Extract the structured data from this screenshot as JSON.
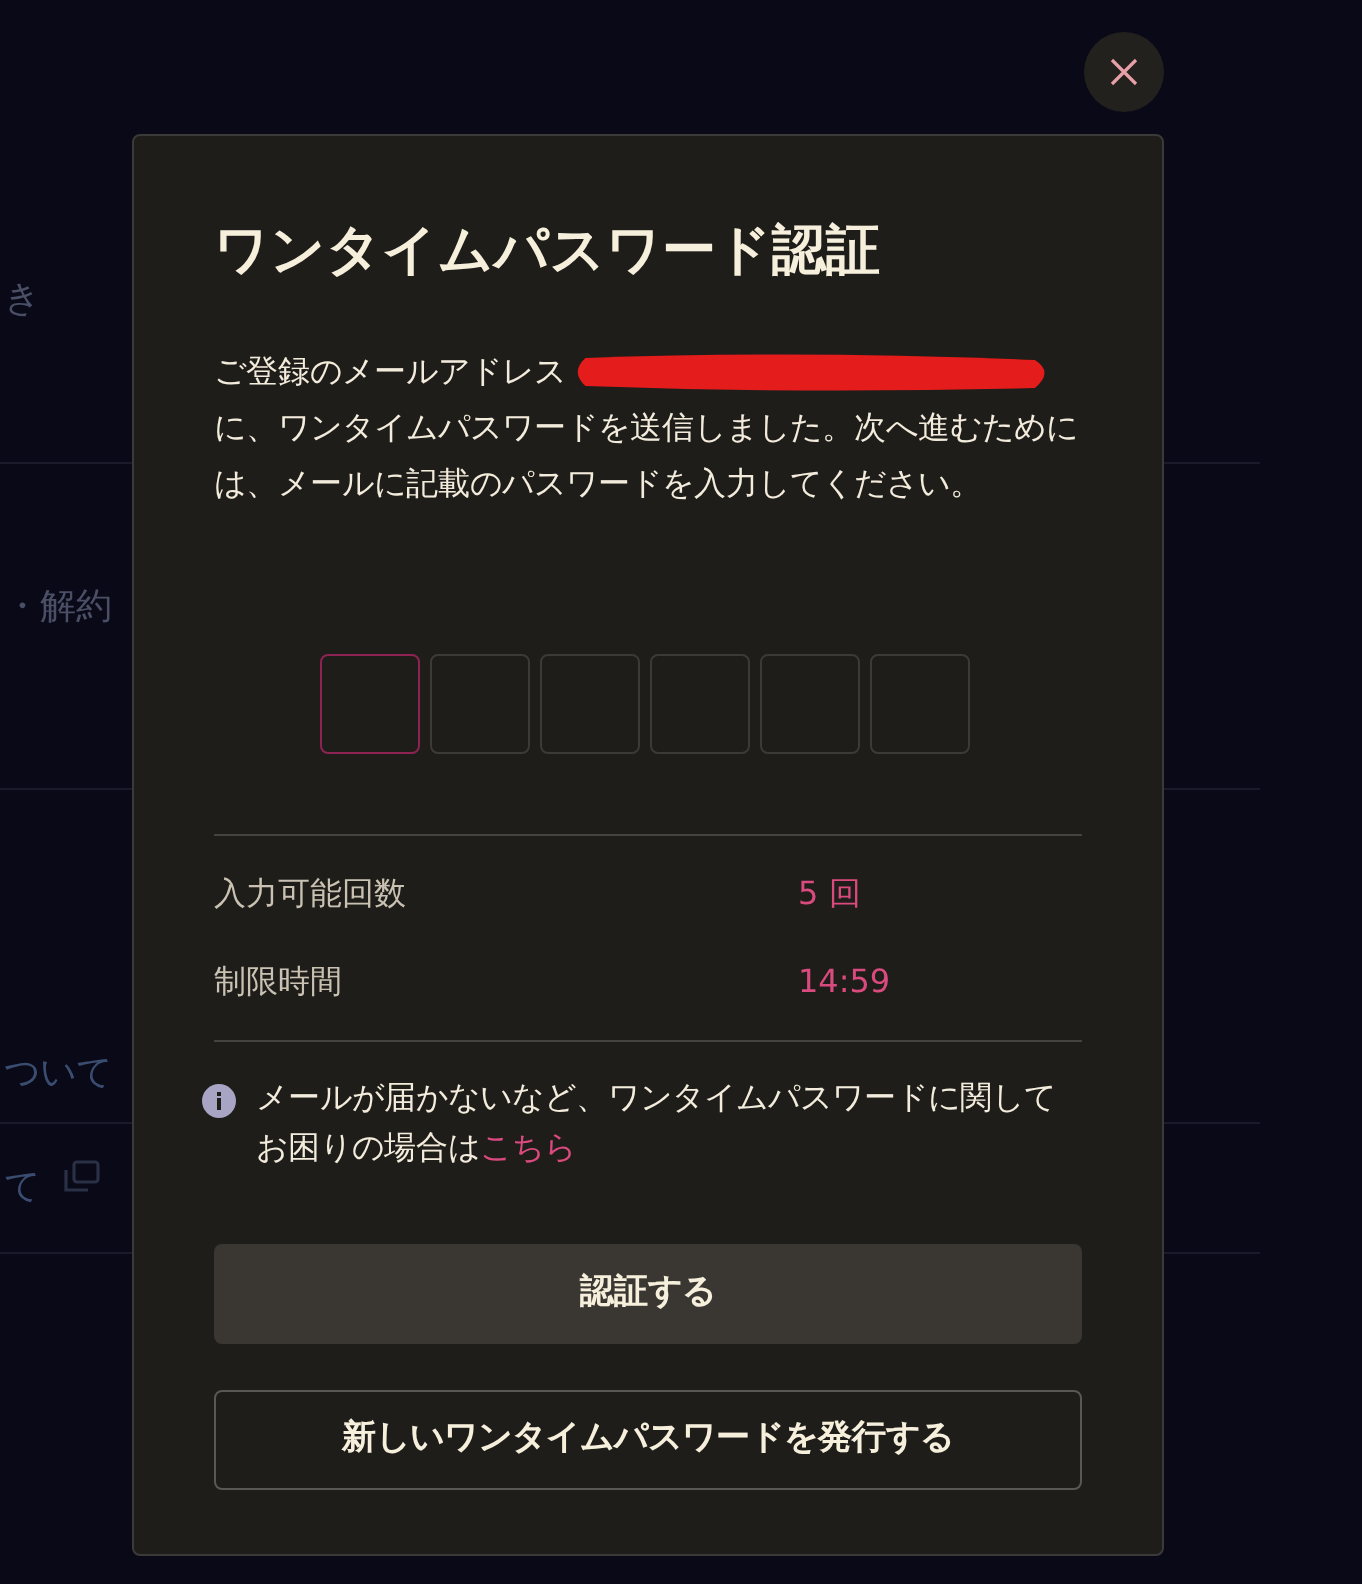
{
  "background_page": {
    "items": [
      {
        "label": "き"
      },
      {
        "label": "・解約"
      },
      {
        "label": "ついて"
      },
      {
        "label": "て",
        "external_link": true
      }
    ]
  },
  "dialog": {
    "title": "ワンタイムパスワード認証",
    "message": {
      "lead": "ご登録のメールアドレス",
      "after_address": "に、ワンタイムパスワードを送信しました。次へ進むためには、メールに記載のパスワードを入力してください。"
    },
    "code_inputs": [
      {
        "focused": true
      },
      {
        "focused": false
      },
      {
        "focused": false
      },
      {
        "focused": false
      },
      {
        "focused": false
      },
      {
        "focused": false
      }
    ],
    "info_rows": [
      {
        "label": "入力可能回数",
        "value": "5 回"
      },
      {
        "label": "制限時間",
        "value": "14:59"
      }
    ],
    "notice": {
      "text": "メールが届かないなど、ワンタイムパスワードに関してお困りの場合は",
      "link": "こちら"
    },
    "buttons": [
      {
        "label": "認証する",
        "kind": "filled"
      },
      {
        "label": "新しいワンタイムパスワードを発行する",
        "kind": "outline"
      }
    ]
  }
}
